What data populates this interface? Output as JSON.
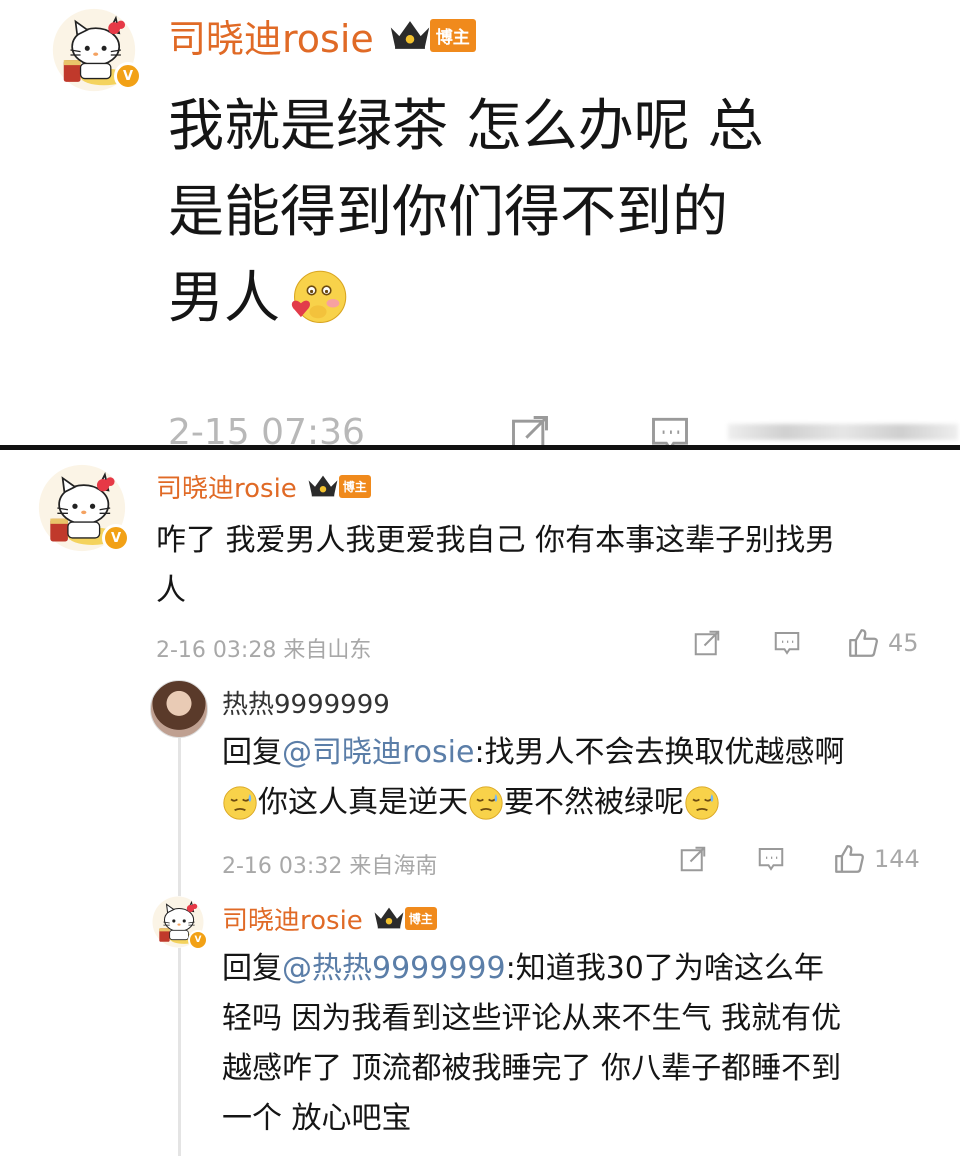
{
  "post": {
    "author": "司晓迪rosie",
    "badge": "博主",
    "text_line1": "我就是绿茶 怎么办呢 总",
    "text_line2": "是能得到你们得不到的",
    "text_line3": "男人",
    "timestamp": "2-15 07:36"
  },
  "comment": {
    "author": "司晓迪rosie",
    "badge": "博主",
    "text_line1": "咋了 我爱男人我更爱我自己 你有本事这辈子别找男",
    "text_line2": "人",
    "timestamp": "2-16 03:28 来自山东",
    "likes": "45"
  },
  "reply1": {
    "author": "热热9999999",
    "prefix": "回复",
    "mention": "@司晓迪rosie",
    "text_line1": ":找男人不会去换取优越感啊",
    "text_line2a": "你这人真是逆天",
    "text_line2b": "要不然被绿呢",
    "timestamp": "2-16 03:32 来自海南",
    "likes": "144"
  },
  "reply2": {
    "author": "司晓迪rosie",
    "badge": "博主",
    "prefix": "回复",
    "mention": "@热热9999999",
    "text_line1": ":知道我30了为啥这么年",
    "text_line2": "轻吗 因为我看到这些评论从来不生气 我就有优",
    "text_line3": "越感咋了 顶流都被我睡完了 你八辈子都睡不到",
    "text_line4": "一个 放心吧宝"
  },
  "icons": {
    "share": "share-icon",
    "comment": "comment-icon",
    "like": "thumbs-up-icon",
    "crown": "crown-icon",
    "verified": "verified-v-icon"
  },
  "colors": {
    "username": "#e06a26",
    "badge": "#f08a1c",
    "mention": "#5b7ea8",
    "meta": "#a8a8a8",
    "verified": "#f2a116"
  }
}
